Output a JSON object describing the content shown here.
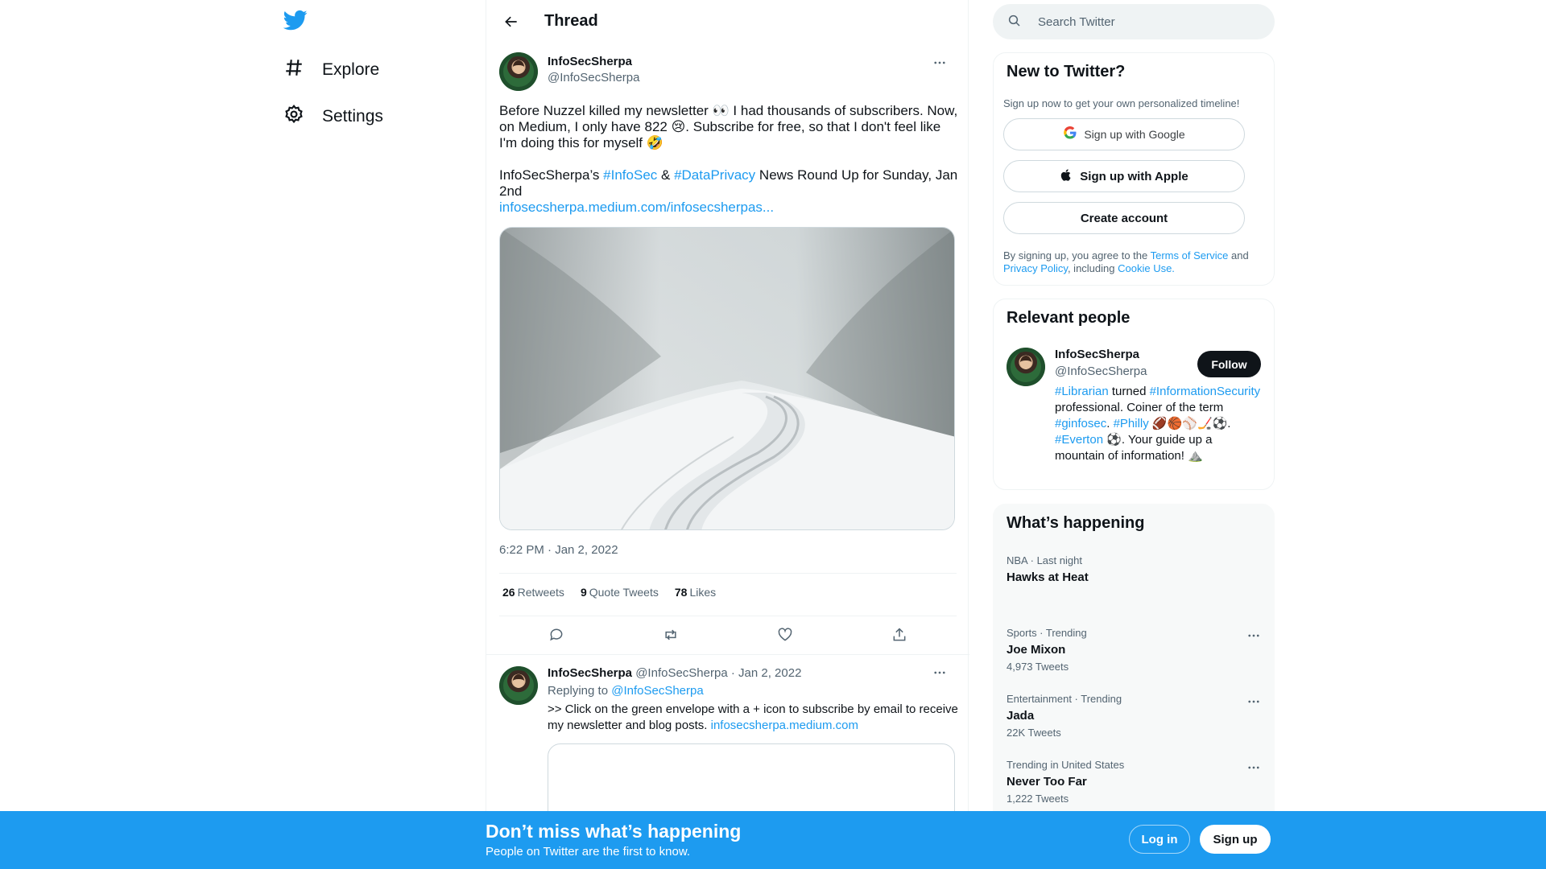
{
  "nav": {
    "logo_icon": "twitter-bird-icon",
    "items": [
      {
        "label": "Explore",
        "icon": "hashtag-icon"
      },
      {
        "label": "Settings",
        "icon": "gear-icon"
      }
    ]
  },
  "thread": {
    "title": "Thread"
  },
  "tweet": {
    "author_name": "InfoSecSherpa",
    "author_handle": "@InfoSecSherpa",
    "text_line1": "Before Nuzzel killed my newsletter 👀 I had thousands of subscribers. Now, on Medium, I only have 822 😢. Subscribe for free, so that I don't feel like I'm doing this for myself 🤣",
    "text_line2_prefix": "InfoSecSherpa’s ",
    "hashtag1": "#InfoSec",
    "amp": " & ",
    "hashtag2": "#DataPrivacy",
    "text_line2_suffix": " News Round Up for Sunday, Jan 2nd",
    "link": "infosecsherpa.medium.com/infosecsherpas...",
    "timestamp": "6:22 PM · Jan 2, 2022",
    "retweets": "26",
    "retweets_label": "Retweets",
    "quotes": "9",
    "quotes_label": "Quote Tweets",
    "likes": "78",
    "likes_label": "Likes"
  },
  "reply": {
    "author_name": "InfoSecSherpa",
    "author_handle": "@InfoSecSherpa",
    "date": "· Jan 2, 2022",
    "replying_label": "Replying to ",
    "replying_handle": "@InfoSecSherpa",
    "text": ">> Click on the green envelope with a + icon to subscribe by email to receive my newsletter and blog posts. ",
    "link": "infosecsherpa.medium.com"
  },
  "search": {
    "placeholder": "Search Twitter"
  },
  "signup_panel": {
    "title": "New to Twitter?",
    "subtitle": "Sign up now to get your own personalized timeline!",
    "google_label": "Sign up with Google",
    "apple_label": "Sign up with Apple",
    "create_label": "Create account",
    "legal_prefix": "By signing up, you agree to the ",
    "terms": "Terms of Service",
    "and": " and ",
    "privacy": "Privacy Policy",
    "including": ", including ",
    "cookie": "Cookie Use."
  },
  "relevant": {
    "title": "Relevant people",
    "name": "InfoSecSherpa",
    "handle": "@InfoSecSherpa",
    "follow_label": "Follow",
    "bio_tag1": "#Librarian",
    "bio_t1": " turned ",
    "bio_tag2": "#InformationSecurity",
    "bio_t2": " professional. Coiner of the term ",
    "bio_tag3": "#ginfosec",
    "bio_t3": ". ",
    "bio_tag4": "#Philly",
    "bio_t4": " 🏈🏀⚾🏒⚽. ",
    "bio_tag5": "#Everton",
    "bio_t5": " ⚽. Your guide up a mountain of information! ⛰️"
  },
  "happening": {
    "title": "What’s happening",
    "trends": [
      {
        "meta": "NBA · Last night",
        "name": "Hawks at Heat",
        "count": ""
      },
      {
        "meta": "Sports · Trending",
        "name": "Joe Mixon",
        "count": "4,973 Tweets"
      },
      {
        "meta": "Entertainment · Trending",
        "name": "Jada",
        "count": "22K Tweets"
      },
      {
        "meta": "Trending in United States",
        "name": "Never Too Far",
        "count": "1,222 Tweets"
      }
    ]
  },
  "banner": {
    "title": "Don’t miss what’s happening",
    "subtitle": "People on Twitter are the first to know.",
    "login_label": "Log in",
    "signup_label": "Sign up"
  },
  "colors": {
    "accent": "#1d9bf0",
    "text": "#0f1419",
    "muted": "#536471"
  }
}
